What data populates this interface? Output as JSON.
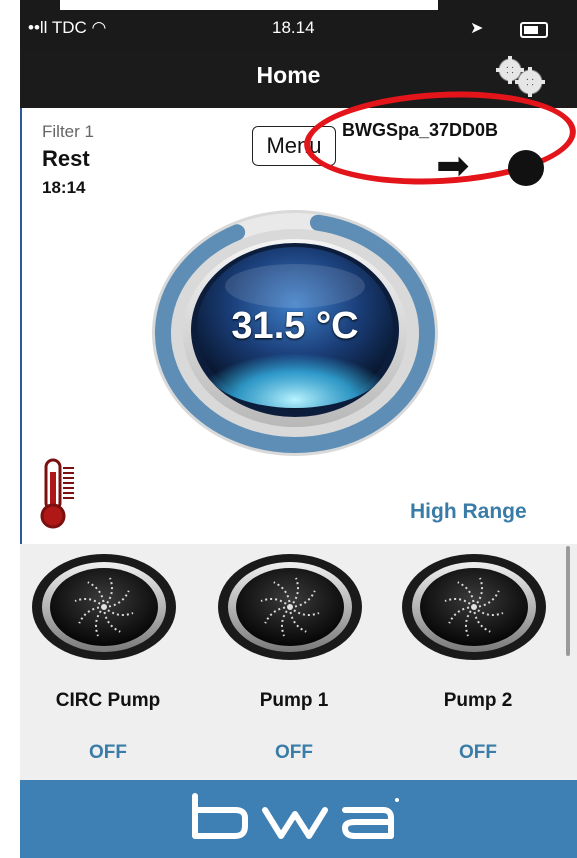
{
  "status_bar": {
    "carrier": "••ll TDC",
    "time": "18.14"
  },
  "nav": {
    "title": "Home",
    "settings_icon": "gears-icon"
  },
  "filter": {
    "label": "Filter 1",
    "mode": "Rest",
    "time": "18:14"
  },
  "menu_button": "Menu",
  "device_name": "BWGSpa_37DD0B",
  "temperature": {
    "value": "31.5 °C",
    "ring_fill_fraction": 0.9
  },
  "range_label": "High Range",
  "pumps": [
    {
      "name": "CIRC Pump",
      "state": "OFF"
    },
    {
      "name": "Pump 1",
      "state": "OFF"
    },
    {
      "name": "Pump 2",
      "state": "OFF"
    }
  ],
  "footer": {
    "brand": "bwa"
  },
  "colors": {
    "accent": "#3a7ca8",
    "footer": "#3e7fb4",
    "annotation": "#e3151a",
    "header": "#1b1b1b"
  }
}
